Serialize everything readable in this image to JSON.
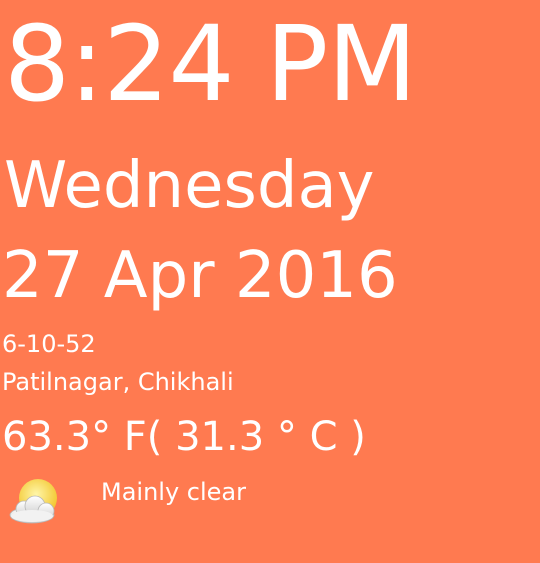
{
  "clock": {
    "time": "8:24 PM",
    "weekday": "Wednesday",
    "date": "27 Apr 2016"
  },
  "info": {
    "code": "6-10-52",
    "location": "Patilnagar, Chikhali",
    "temperature": "63.3° F( 31.3 ° C )"
  },
  "weather": {
    "icon": "partly-cloudy-sun-icon",
    "condition": "Mainly clear"
  },
  "colors": {
    "background": "#FF7A50",
    "text": "#FFFFFF",
    "sun": "#F6D84A",
    "cloud": "#E8E8E8"
  }
}
